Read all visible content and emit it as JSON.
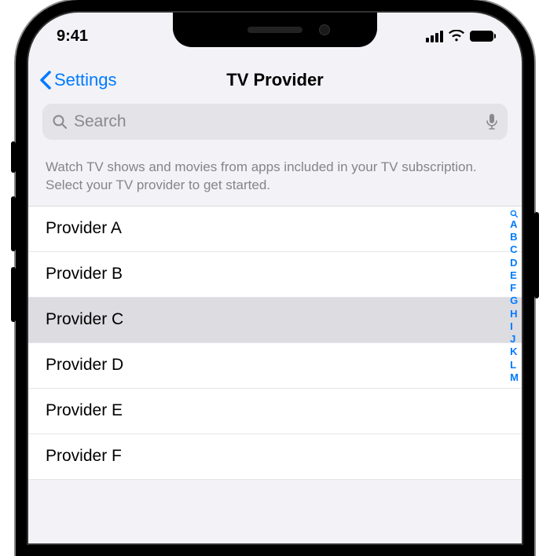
{
  "status_bar": {
    "time": "9:41"
  },
  "nav": {
    "back_label": "Settings",
    "title": "TV Provider"
  },
  "search": {
    "placeholder": "Search"
  },
  "description": "Watch TV shows and movies from apps included in your TV subscription. Select your TV provider to get started.",
  "providers": [
    {
      "name": "Provider A",
      "selected": false
    },
    {
      "name": "Provider B",
      "selected": false
    },
    {
      "name": "Provider C",
      "selected": true
    },
    {
      "name": "Provider D",
      "selected": false
    },
    {
      "name": "Provider E",
      "selected": false
    },
    {
      "name": "Provider F",
      "selected": false
    }
  ],
  "index": [
    "A",
    "B",
    "C",
    "D",
    "E",
    "F",
    "G",
    "H",
    "I",
    "J",
    "K",
    "L",
    "M"
  ],
  "colors": {
    "accent": "#007aff",
    "background": "#f2f2f7",
    "search_bg": "#e3e3e8",
    "secondary_text": "#8a8a8e"
  }
}
